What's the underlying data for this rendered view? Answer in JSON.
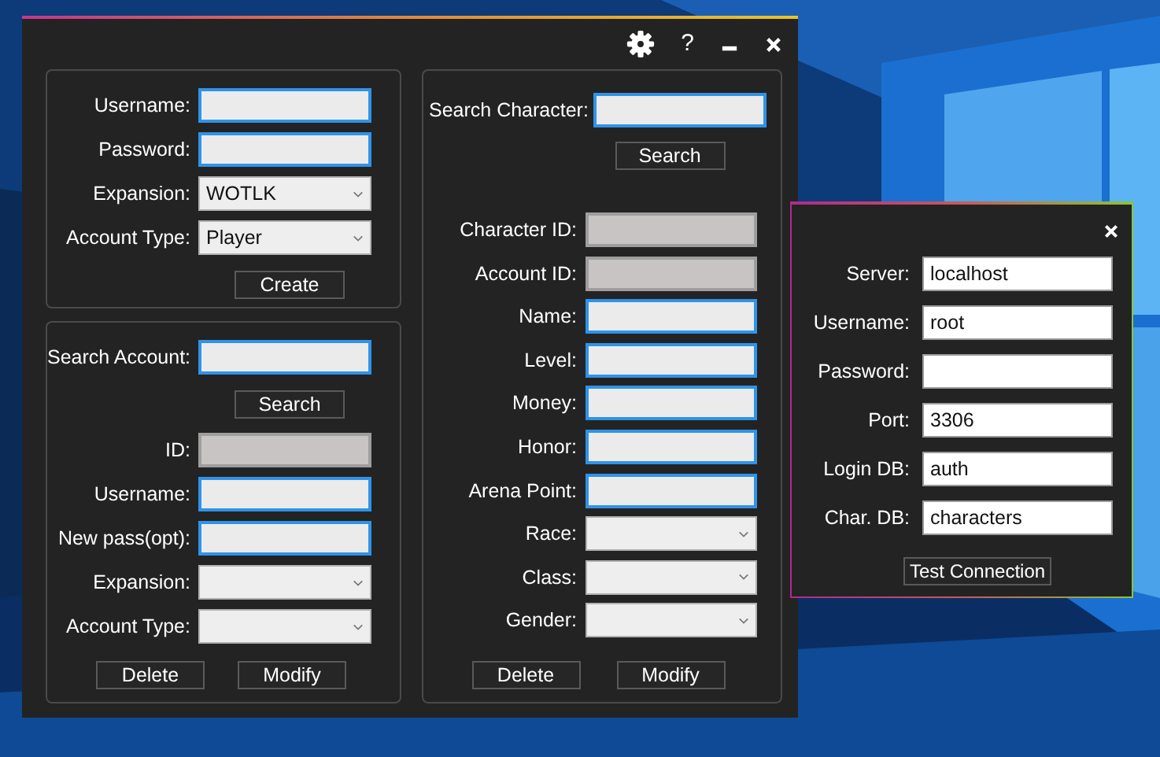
{
  "main_window": {
    "help_label": "?",
    "title_buttons": [
      {
        "kind": "settings"
      },
      {
        "kind": "help"
      },
      {
        "kind": "minimize"
      },
      {
        "kind": "close"
      }
    ]
  },
  "create_account": {
    "fields": [
      {
        "label": "Username:",
        "kind": "input"
      },
      {
        "label": "Password:",
        "kind": "input"
      },
      {
        "label": "Expansion:",
        "kind": "select",
        "value": "WOTLK"
      },
      {
        "label": "Account Type:",
        "kind": "select",
        "value": "Player"
      }
    ],
    "button": "Create"
  },
  "account_search": {
    "search_label": "Search Account:",
    "search_button": "Search",
    "fields": [
      {
        "label": "ID:",
        "kind": "readonly"
      },
      {
        "label": "Username:",
        "kind": "input"
      },
      {
        "label": "New pass(opt):",
        "kind": "input"
      },
      {
        "label": "Expansion:",
        "kind": "select"
      },
      {
        "label": "Account Type:",
        "kind": "select"
      }
    ],
    "buttons": [
      "Delete",
      "Modify"
    ]
  },
  "character": {
    "search_label": "Search Character:",
    "search_button": "Search",
    "fields": [
      {
        "label": "Character ID:",
        "kind": "readonly"
      },
      {
        "label": "Account ID:",
        "kind": "readonly"
      },
      {
        "label": "Name:",
        "kind": "input"
      },
      {
        "label": "Level:",
        "kind": "input"
      },
      {
        "label": "Money:",
        "kind": "input"
      },
      {
        "label": "Honor:",
        "kind": "input"
      },
      {
        "label": "Arena Point:",
        "kind": "input"
      },
      {
        "label": "Race:",
        "kind": "select"
      },
      {
        "label": "Class:",
        "kind": "select"
      },
      {
        "label": "Gender:",
        "kind": "select"
      }
    ],
    "buttons": [
      "Delete",
      "Modify"
    ]
  },
  "connection_dialog": {
    "fields": [
      {
        "label": "Server:",
        "kind": "text",
        "value": "localhost"
      },
      {
        "label": "Username:",
        "kind": "text",
        "value": "root"
      },
      {
        "label": "Password:",
        "kind": "text"
      },
      {
        "label": "Port:",
        "kind": "text",
        "value": "3306"
      },
      {
        "label": "Login DB:",
        "kind": "text",
        "value": "auth"
      },
      {
        "label": "Char. DB:",
        "kind": "text",
        "value": "characters"
      }
    ],
    "button": "Test Connection"
  }
}
